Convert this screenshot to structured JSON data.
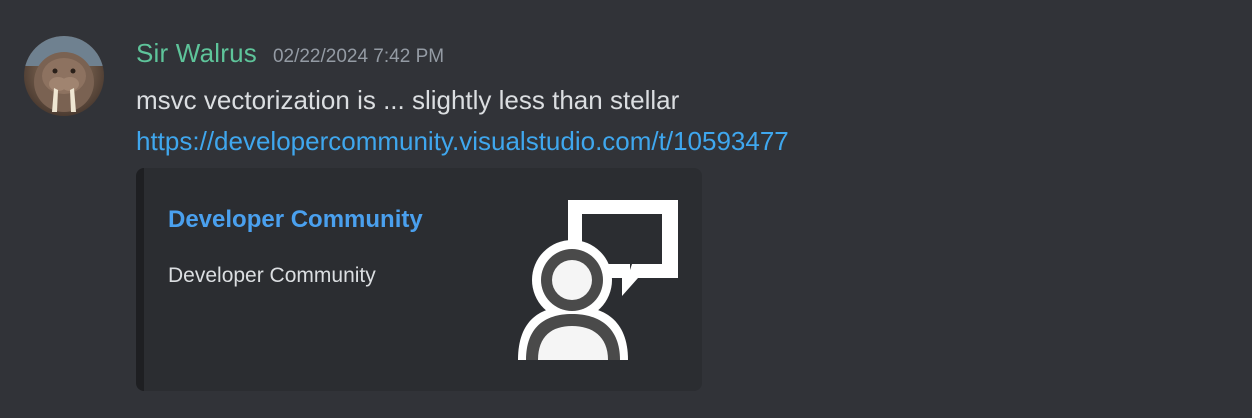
{
  "message": {
    "author": "Sir Walrus",
    "timestamp": "02/22/2024 7:42 PM",
    "content": "msvc vectorization is ... slightly less than stellar",
    "link": "https://developercommunity.visualstudio.com/t/10593477"
  },
  "embed": {
    "title": "Developer Community",
    "description": "Developer Community",
    "thumbnail_icon": "person-with-speech-bubble-icon"
  },
  "colors": {
    "background": "#313338",
    "username": "#5ec49a",
    "link": "#3fa7ee",
    "embed_background": "#2b2d31"
  }
}
